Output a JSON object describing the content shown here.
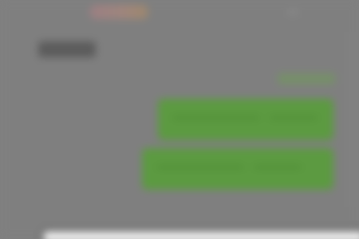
{
  "header": {
    "logo": "brand-logo",
    "title": ""
  },
  "main": {
    "link_label": "",
    "cards": [
      {
        "label": "",
        "color": "#5c9a41"
      },
      {
        "label": "",
        "color": "#5c9a41"
      }
    ]
  },
  "bottom": {
    "input_placeholder": ""
  },
  "colors": {
    "background": "#7f7f7f",
    "accent_green": "#5c9a41",
    "input_bg": "#f2f2f2"
  }
}
